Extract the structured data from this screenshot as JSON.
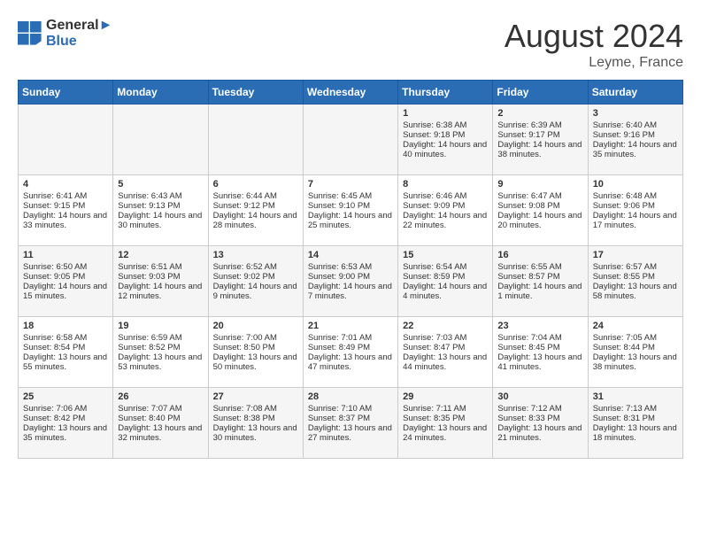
{
  "header": {
    "logo_line1": "General",
    "logo_line2": "Blue",
    "month_year": "August 2024",
    "location": "Leyme, France"
  },
  "days_of_week": [
    "Sunday",
    "Monday",
    "Tuesday",
    "Wednesday",
    "Thursday",
    "Friday",
    "Saturday"
  ],
  "weeks": [
    [
      {
        "day": "",
        "content": ""
      },
      {
        "day": "",
        "content": ""
      },
      {
        "day": "",
        "content": ""
      },
      {
        "day": "",
        "content": ""
      },
      {
        "day": "1",
        "content": "Sunrise: 6:38 AM\nSunset: 9:18 PM\nDaylight: 14 hours and 40 minutes."
      },
      {
        "day": "2",
        "content": "Sunrise: 6:39 AM\nSunset: 9:17 PM\nDaylight: 14 hours and 38 minutes."
      },
      {
        "day": "3",
        "content": "Sunrise: 6:40 AM\nSunset: 9:16 PM\nDaylight: 14 hours and 35 minutes."
      }
    ],
    [
      {
        "day": "4",
        "content": "Sunrise: 6:41 AM\nSunset: 9:15 PM\nDaylight: 14 hours and 33 minutes."
      },
      {
        "day": "5",
        "content": "Sunrise: 6:43 AM\nSunset: 9:13 PM\nDaylight: 14 hours and 30 minutes."
      },
      {
        "day": "6",
        "content": "Sunrise: 6:44 AM\nSunset: 9:12 PM\nDaylight: 14 hours and 28 minutes."
      },
      {
        "day": "7",
        "content": "Sunrise: 6:45 AM\nSunset: 9:10 PM\nDaylight: 14 hours and 25 minutes."
      },
      {
        "day": "8",
        "content": "Sunrise: 6:46 AM\nSunset: 9:09 PM\nDaylight: 14 hours and 22 minutes."
      },
      {
        "day": "9",
        "content": "Sunrise: 6:47 AM\nSunset: 9:08 PM\nDaylight: 14 hours and 20 minutes."
      },
      {
        "day": "10",
        "content": "Sunrise: 6:48 AM\nSunset: 9:06 PM\nDaylight: 14 hours and 17 minutes."
      }
    ],
    [
      {
        "day": "11",
        "content": "Sunrise: 6:50 AM\nSunset: 9:05 PM\nDaylight: 14 hours and 15 minutes."
      },
      {
        "day": "12",
        "content": "Sunrise: 6:51 AM\nSunset: 9:03 PM\nDaylight: 14 hours and 12 minutes."
      },
      {
        "day": "13",
        "content": "Sunrise: 6:52 AM\nSunset: 9:02 PM\nDaylight: 14 hours and 9 minutes."
      },
      {
        "day": "14",
        "content": "Sunrise: 6:53 AM\nSunset: 9:00 PM\nDaylight: 14 hours and 7 minutes."
      },
      {
        "day": "15",
        "content": "Sunrise: 6:54 AM\nSunset: 8:59 PM\nDaylight: 14 hours and 4 minutes."
      },
      {
        "day": "16",
        "content": "Sunrise: 6:55 AM\nSunset: 8:57 PM\nDaylight: 14 hours and 1 minute."
      },
      {
        "day": "17",
        "content": "Sunrise: 6:57 AM\nSunset: 8:55 PM\nDaylight: 13 hours and 58 minutes."
      }
    ],
    [
      {
        "day": "18",
        "content": "Sunrise: 6:58 AM\nSunset: 8:54 PM\nDaylight: 13 hours and 55 minutes."
      },
      {
        "day": "19",
        "content": "Sunrise: 6:59 AM\nSunset: 8:52 PM\nDaylight: 13 hours and 53 minutes."
      },
      {
        "day": "20",
        "content": "Sunrise: 7:00 AM\nSunset: 8:50 PM\nDaylight: 13 hours and 50 minutes."
      },
      {
        "day": "21",
        "content": "Sunrise: 7:01 AM\nSunset: 8:49 PM\nDaylight: 13 hours and 47 minutes."
      },
      {
        "day": "22",
        "content": "Sunrise: 7:03 AM\nSunset: 8:47 PM\nDaylight: 13 hours and 44 minutes."
      },
      {
        "day": "23",
        "content": "Sunrise: 7:04 AM\nSunset: 8:45 PM\nDaylight: 13 hours and 41 minutes."
      },
      {
        "day": "24",
        "content": "Sunrise: 7:05 AM\nSunset: 8:44 PM\nDaylight: 13 hours and 38 minutes."
      }
    ],
    [
      {
        "day": "25",
        "content": "Sunrise: 7:06 AM\nSunset: 8:42 PM\nDaylight: 13 hours and 35 minutes."
      },
      {
        "day": "26",
        "content": "Sunrise: 7:07 AM\nSunset: 8:40 PM\nDaylight: 13 hours and 32 minutes."
      },
      {
        "day": "27",
        "content": "Sunrise: 7:08 AM\nSunset: 8:38 PM\nDaylight: 13 hours and 30 minutes."
      },
      {
        "day": "28",
        "content": "Sunrise: 7:10 AM\nSunset: 8:37 PM\nDaylight: 13 hours and 27 minutes."
      },
      {
        "day": "29",
        "content": "Sunrise: 7:11 AM\nSunset: 8:35 PM\nDaylight: 13 hours and 24 minutes."
      },
      {
        "day": "30",
        "content": "Sunrise: 7:12 AM\nSunset: 8:33 PM\nDaylight: 13 hours and 21 minutes."
      },
      {
        "day": "31",
        "content": "Sunrise: 7:13 AM\nSunset: 8:31 PM\nDaylight: 13 hours and 18 minutes."
      }
    ]
  ]
}
